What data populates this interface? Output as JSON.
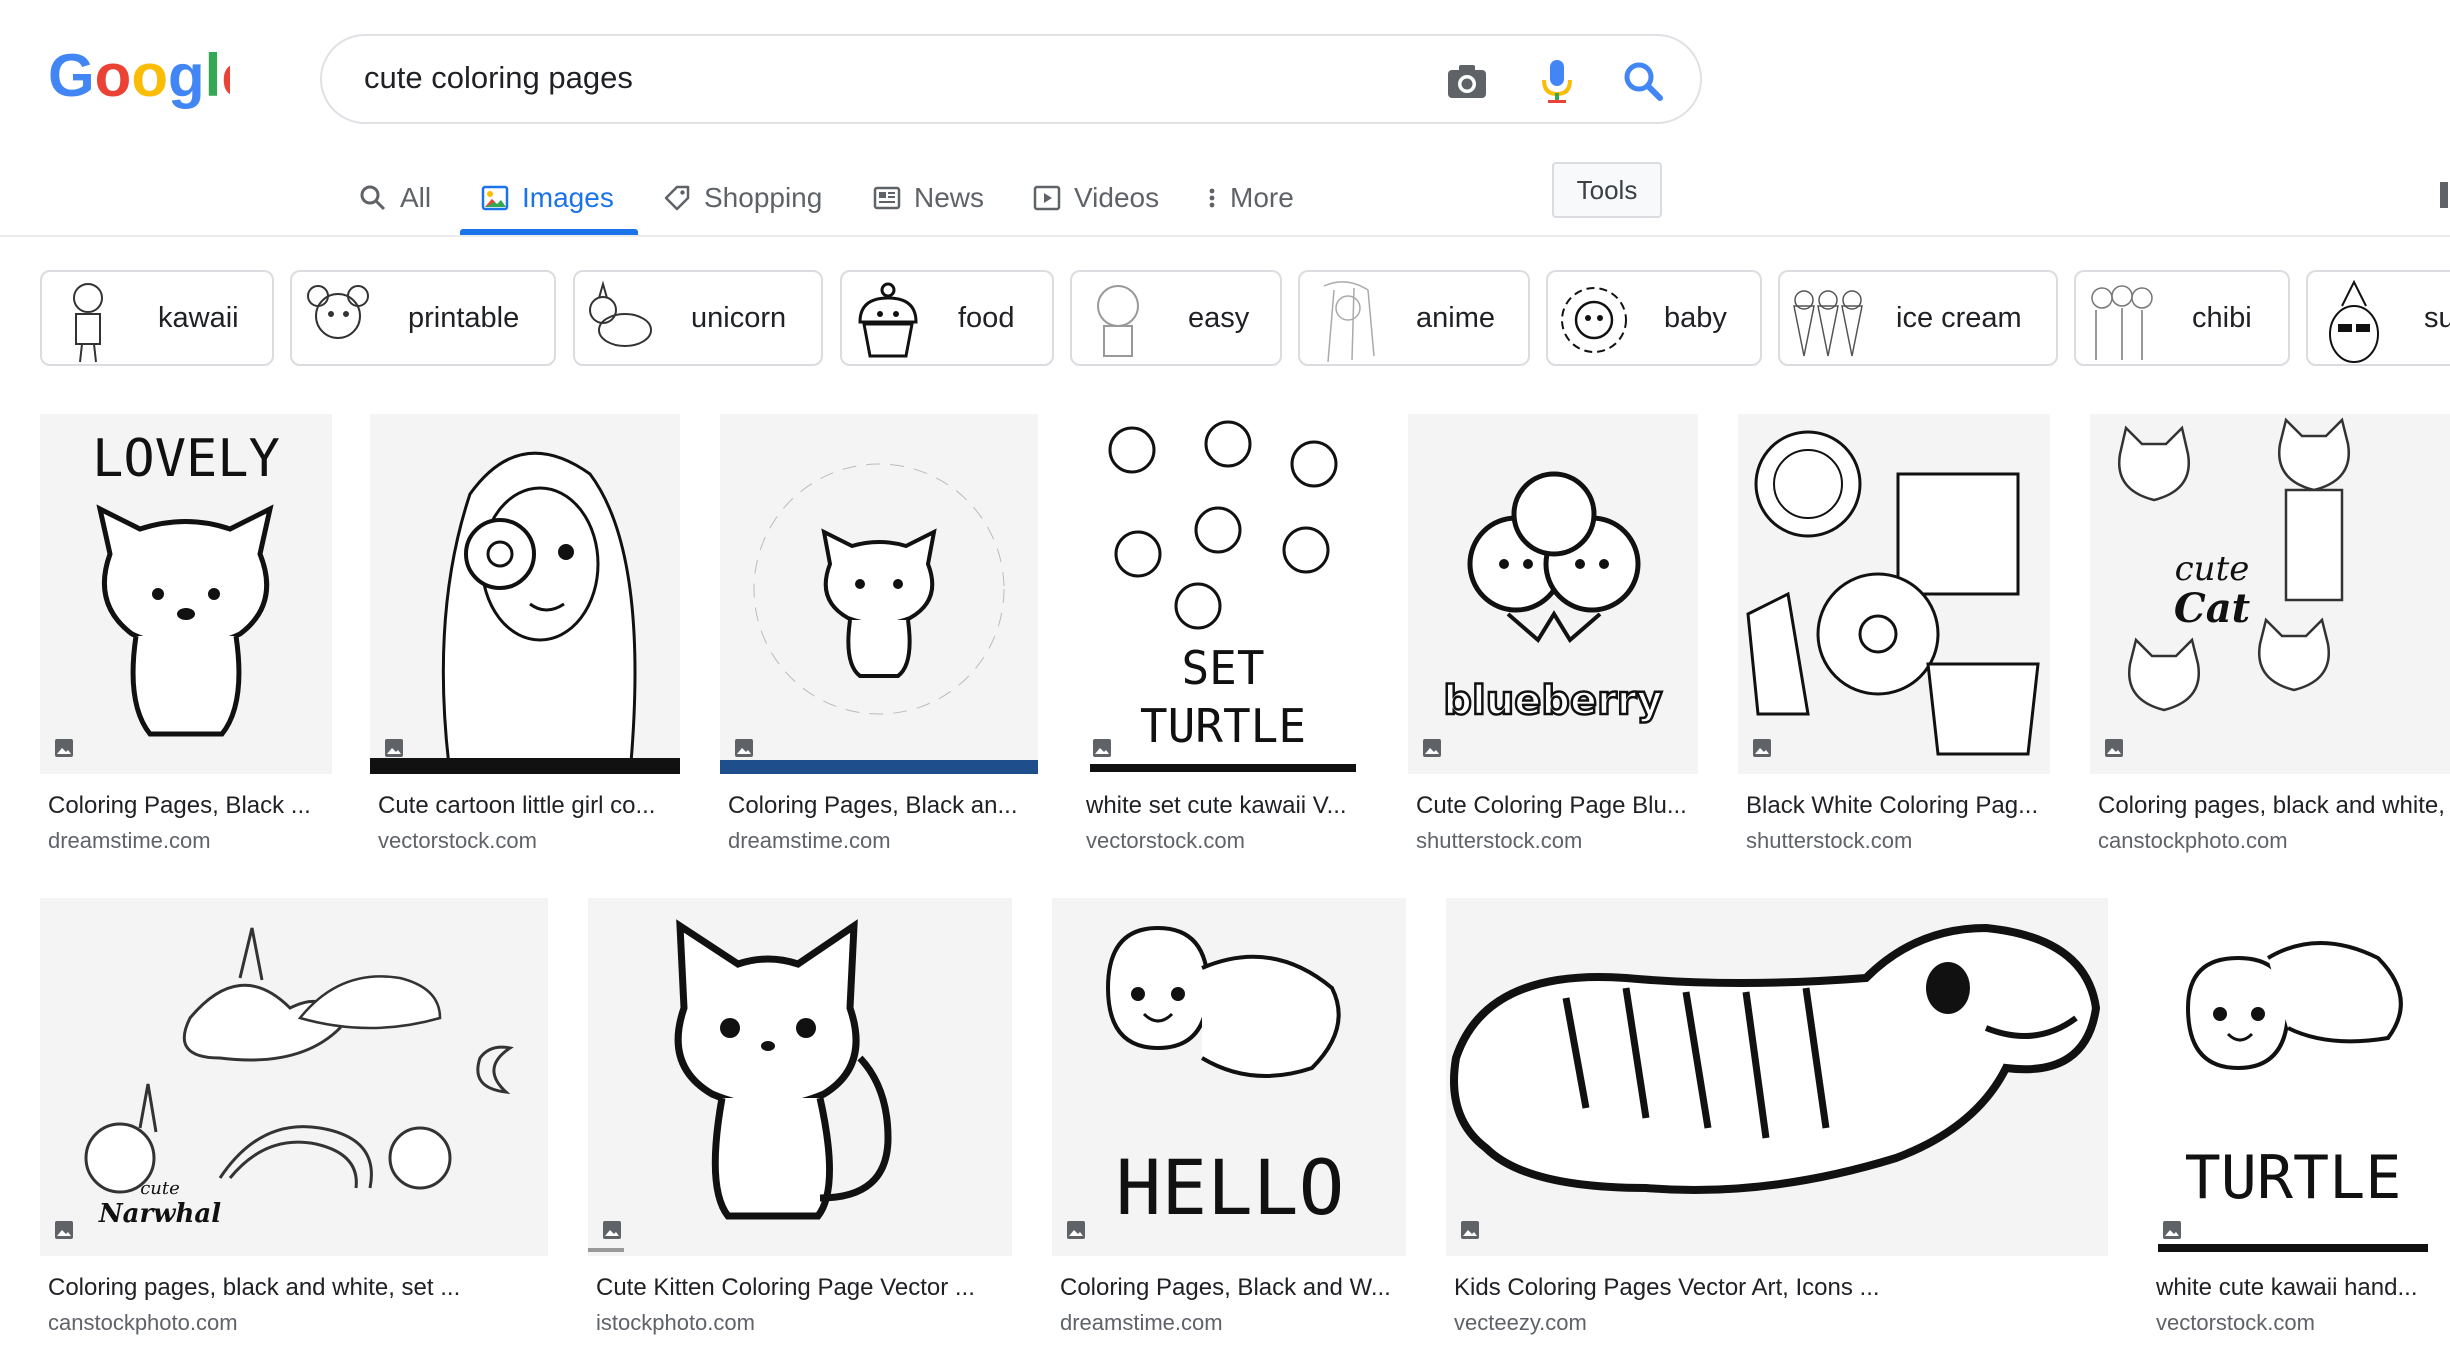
{
  "header": {
    "logo": "Google",
    "search": {
      "value": "cute coloring pages"
    }
  },
  "tabs": [
    {
      "label": "All",
      "icon": "search-icon"
    },
    {
      "label": "Images",
      "icon": "image-icon",
      "active": true
    },
    {
      "label": "Shopping",
      "icon": "tag-icon"
    },
    {
      "label": "News",
      "icon": "newspaper-icon"
    },
    {
      "label": "Videos",
      "icon": "play-icon"
    },
    {
      "label": "More",
      "icon": "more-vert-icon"
    }
  ],
  "tools_label": "Tools",
  "chips": [
    "kawaii",
    "printable",
    "unicorn",
    "food",
    "easy",
    "anime",
    "baby",
    "ice cream",
    "chibi",
    "su"
  ],
  "results": {
    "row1": [
      {
        "title": "Coloring Pages, Black ...",
        "source": "dreamstime.com",
        "overlay_lines": [
          "LOVELY"
        ]
      },
      {
        "title": "Cute cartoon little girl co...",
        "source": "vectorstock.com",
        "overlay_lines": []
      },
      {
        "title": "Coloring Pages, Black an...",
        "source": "dreamstime.com",
        "overlay_lines": []
      },
      {
        "title": "white set cute kawaii V...",
        "source": "vectorstock.com",
        "overlay_lines": [
          "SET",
          "TURTLE"
        ]
      },
      {
        "title": "Cute Coloring Page Blu...",
        "source": "shutterstock.com",
        "overlay_lines": [
          "blueberry"
        ]
      },
      {
        "title": "Black White Coloring Pag...",
        "source": "shutterstock.com",
        "overlay_lines": []
      },
      {
        "title": "Coloring pages, black and white,",
        "source": "canstockphoto.com",
        "overlay_lines": [
          "cute",
          "Cat"
        ]
      }
    ],
    "row2": [
      {
        "title": "Coloring pages, black and white, set ...",
        "source": "canstockphoto.com",
        "overlay_lines": [
          "cute",
          "Narwhal"
        ]
      },
      {
        "title": "Cute Kitten Coloring Page Vector ...",
        "source": "istockphoto.com",
        "overlay_lines": []
      },
      {
        "title": "Coloring Pages, Black and W...",
        "source": "dreamstime.com",
        "overlay_lines": [
          "HELLO"
        ]
      },
      {
        "title": "Kids Coloring Pages Vector Art, Icons ...",
        "source": "vecteezy.com",
        "overlay_lines": []
      },
      {
        "title": "white cute kawaii hand...",
        "source": "vectorstock.com",
        "overlay_lines": [
          "TURTLE"
        ]
      }
    ]
  },
  "colors": {
    "accent": "#1a73e8",
    "text": "#202124",
    "secondary": "#5f6368",
    "border": "#dadce0"
  }
}
